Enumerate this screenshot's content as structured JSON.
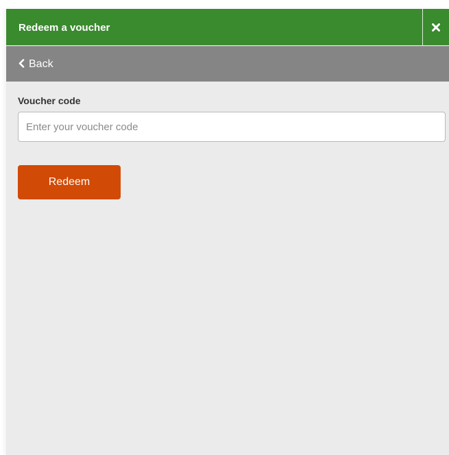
{
  "header": {
    "title": "Redeem a voucher",
    "close_icon": "close-icon",
    "background_color": "#3a8a2e"
  },
  "nav": {
    "back_label": "Back",
    "back_icon": "chevron-left-icon",
    "background_color": "#858585"
  },
  "form": {
    "voucher_label": "Voucher code",
    "voucher_value": "",
    "voucher_placeholder": "Enter your voucher code",
    "submit_label": "Redeem",
    "submit_color": "#d14a06"
  }
}
